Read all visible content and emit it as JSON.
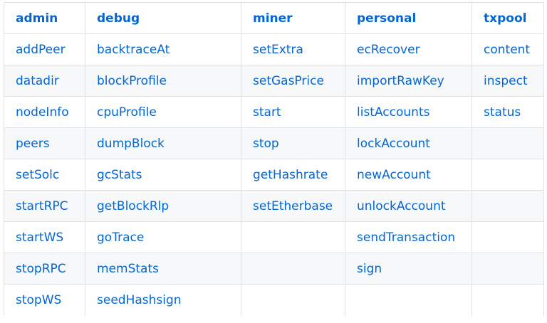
{
  "table": {
    "headers": [
      "admin",
      "debug",
      "miner",
      "personal",
      "txpool"
    ],
    "rows": [
      [
        "addPeer",
        "backtraceAt",
        "setExtra",
        "ecRecover",
        "content"
      ],
      [
        "datadir",
        "blockProfile",
        "setGasPrice",
        "importRawKey",
        "inspect"
      ],
      [
        "nodeInfo",
        "cpuProfile",
        "start",
        "listAccounts",
        "status"
      ],
      [
        "peers",
        "dumpBlock",
        "stop",
        "lockAccount",
        ""
      ],
      [
        "setSolc",
        "gcStats",
        "getHashrate",
        "newAccount",
        ""
      ],
      [
        "startRPC",
        "getBlockRlp",
        "setEtherbase",
        "unlockAccount",
        ""
      ],
      [
        "startWS",
        "goTrace",
        "",
        "sendTransaction",
        ""
      ],
      [
        "stopRPC",
        "memStats",
        "",
        "sign",
        ""
      ],
      [
        "stopWS",
        "seedHashsign",
        "",
        "",
        ""
      ]
    ]
  },
  "colors": {
    "link": "#0366d6",
    "border": "#dfe2e5",
    "stripe": "#f6f8fa"
  }
}
